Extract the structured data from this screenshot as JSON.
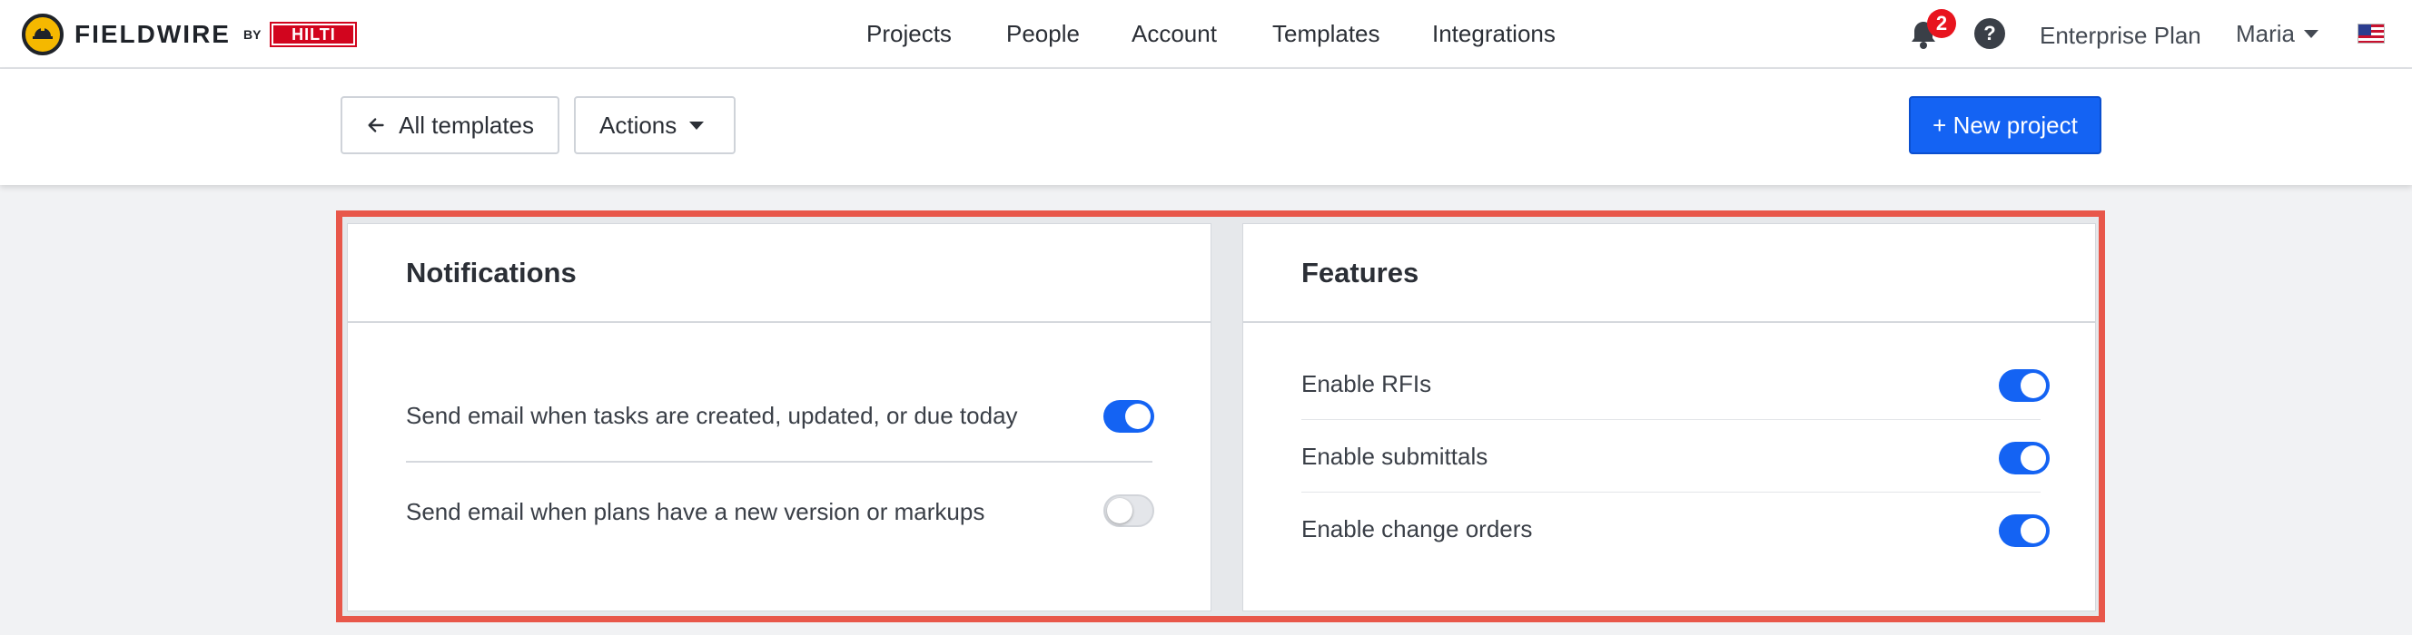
{
  "brand": {
    "name": "FIELDWIRE",
    "by": "BY",
    "partner": "HILTI"
  },
  "nav": {
    "items": [
      "Projects",
      "People",
      "Account",
      "Templates",
      "Integrations"
    ]
  },
  "header": {
    "notifications_count": "2",
    "help": "?",
    "plan": "Enterprise Plan",
    "user": "Maria"
  },
  "toolbar": {
    "back_label": "All templates",
    "actions_label": "Actions",
    "new_project_label": "+ New project"
  },
  "notifications": {
    "title": "Notifications",
    "items": [
      {
        "label": "Send email when tasks are created, updated, or due today",
        "enabled": true
      },
      {
        "label": "Send email when plans have a new version or markups",
        "enabled": false
      }
    ]
  },
  "features": {
    "title": "Features",
    "items": [
      {
        "label": "Enable RFIs",
        "enabled": true
      },
      {
        "label": "Enable submittals",
        "enabled": true
      },
      {
        "label": "Enable change orders",
        "enabled": true
      }
    ]
  },
  "colors": {
    "primary": "#1463f3",
    "highlight_border": "#e8574a",
    "badge": "#e8141e",
    "logo": "#f5b800"
  }
}
